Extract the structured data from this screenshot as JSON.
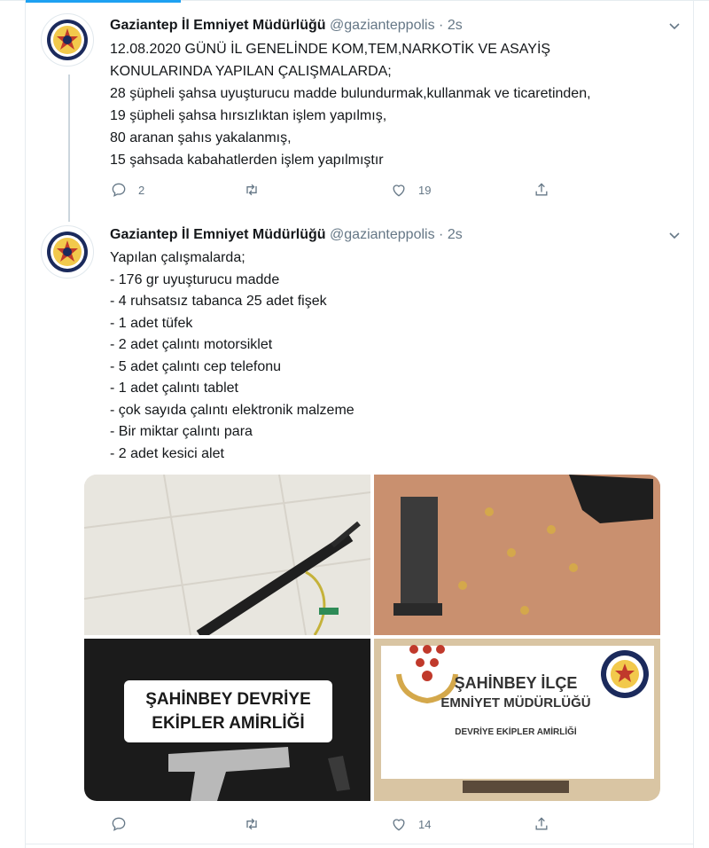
{
  "colors": {
    "accent": "#1da1f2",
    "text": "#14171a",
    "muted": "#657786",
    "border": "#e6ecf0"
  },
  "icons": {
    "reply": "reply-icon",
    "retweet": "retweet-icon",
    "like": "heart-icon",
    "share": "share-icon",
    "more": "chevron-down-icon"
  },
  "tweets": [
    {
      "name": "Gaziantep İl Emniyet Müdürlüğü",
      "handle": "@gazianteppolis",
      "dot": "·",
      "time": "2s",
      "lines": [
        "12.08.2020 GÜNÜ İL GENELİNDE KOM,TEM,NARKOTİK VE ASAYİŞ",
        "KONULARINDA YAPILAN ÇALIŞMALARDA;",
        "28 şüpheli şahsa uyuşturucu madde bulundurmak,kullanmak ve  ticaretinden,",
        "19 şüpheli şahsa hırsızlıktan işlem yapılmış,",
        "80 aranan şahıs yakalanmış,",
        "15 şahsada kabahatlerden işlem yapılmıştır"
      ],
      "reply_count": "2",
      "retweet_count": "",
      "like_count": "19"
    },
    {
      "name": "Gaziantep İl Emniyet Müdürlüğü",
      "handle": "@gazianteppolis",
      "dot": "·",
      "time": "2s",
      "lines": [
        "Yapılan çalışmalarda;",
        "- 176 gr uyuşturucu madde",
        "- 4 ruhsatsız tabanca 25 adet fişek",
        "- 1 adet tüfek",
        "- 2 adet çalıntı motorsiklet",
        "- 5 adet çalıntı cep telefonu",
        "- 1 adet çalıntı tablet",
        "- çok sayıda çalıntı elektronik malzeme",
        "- Bir miktar çalıntı para",
        "- 2 adet kesici alet"
      ],
      "reply_count": "",
      "retweet_count": "",
      "like_count": "14",
      "media": {
        "sign1": [
          "ŞAHİNBEY DEVRİYE",
          "EKİPLER AMİRLİĞİ"
        ],
        "sign2": [
          "ŞAHİNBEY İLÇE",
          "EMNİYET MÜDÜRLÜĞÜ",
          "DEVRİYE EKİPLER AMİRLİĞİ"
        ]
      }
    }
  ]
}
